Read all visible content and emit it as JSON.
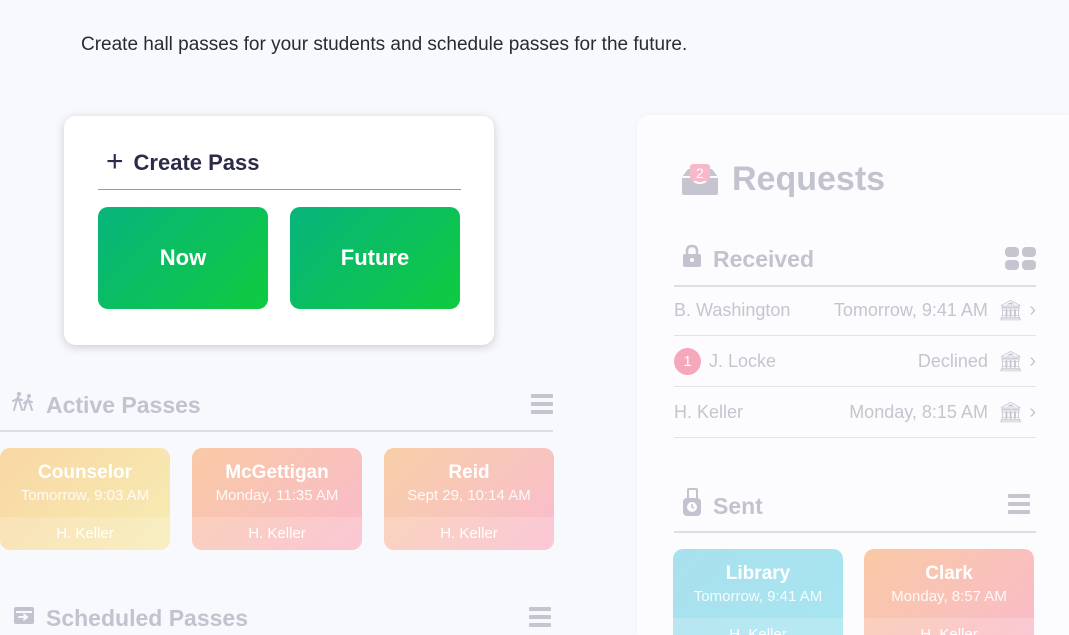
{
  "intro": "Create hall passes for your students and schedule passes for the future.",
  "create_pass": {
    "title": "Create Pass",
    "now_label": "Now",
    "future_label": "Future"
  },
  "active_passes": {
    "title": "Active Passes",
    "items": [
      {
        "name": "Counselor",
        "time": "Tomorrow, 9:03 AM",
        "owner": "H. Keller"
      },
      {
        "name": "McGettigan",
        "time": "Monday, 11:35 AM",
        "owner": "H. Keller"
      },
      {
        "name": "Reid",
        "time": "Sept 29, 10:14 AM",
        "owner": "H. Keller"
      }
    ]
  },
  "scheduled_passes": {
    "title": "Scheduled Passes"
  },
  "requests": {
    "title": "Requests",
    "inbox_count": "2",
    "received": {
      "title": "Received",
      "rows": [
        {
          "name": "B. Washington",
          "status": "Tomorrow, 9:41 AM",
          "badge": ""
        },
        {
          "name": "J. Locke",
          "status": "Declined",
          "badge": "1"
        },
        {
          "name": "H. Keller",
          "status": "Monday, 8:15 AM",
          "badge": ""
        }
      ]
    },
    "sent": {
      "title": "Sent",
      "items": [
        {
          "name": "Library",
          "time": "Tomorrow, 9:41 AM",
          "owner": "H. Keller"
        },
        {
          "name": "Clark",
          "time": "Monday, 8:57 AM",
          "owner": "H. Keller"
        }
      ]
    }
  },
  "colors": {
    "accent_green_start": "#07b47d",
    "accent_green_end": "#0fcb3e",
    "badge_pink": "#f5a7bb"
  }
}
